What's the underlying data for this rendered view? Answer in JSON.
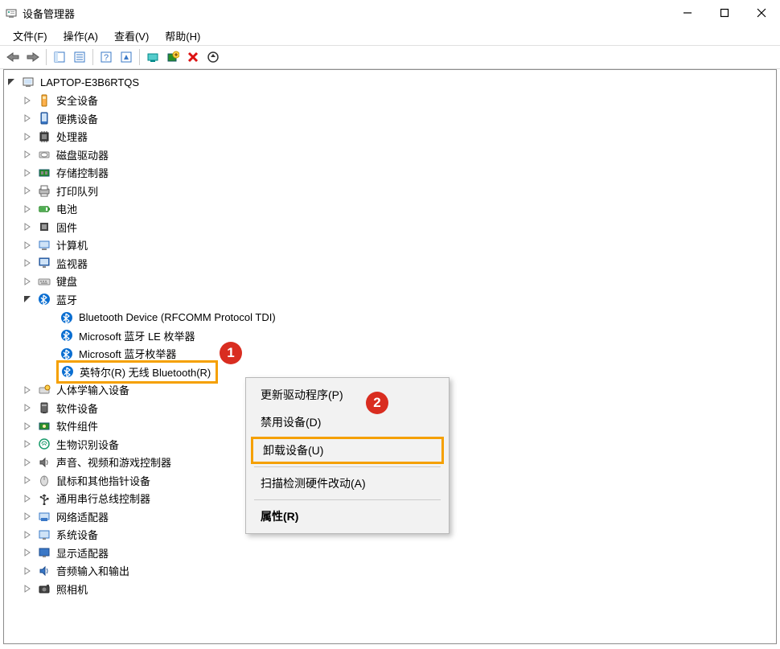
{
  "window": {
    "title": "设备管理器"
  },
  "menu": {
    "file": "文件(F)",
    "action": "操作(A)",
    "view": "查看(V)",
    "help": "帮助(H)"
  },
  "toolbar_icons": {
    "back": "back-arrow-icon",
    "forward": "forward-arrow-icon",
    "properties_panel": "panel-icon",
    "console": "console-icon",
    "help": "help-icon",
    "show_hidden": "show-icon",
    "scan": "scan-icon",
    "add_legacy": "add-hw-icon",
    "uninstall": "uninstall-x-icon",
    "update_driver": "update-driver-icon"
  },
  "root_name": "LAPTOP-E3B6RTQS",
  "categories": [
    {
      "label": "安全设备",
      "icon": "security-device-icon",
      "expanded": false
    },
    {
      "label": "便携设备",
      "icon": "portable-device-icon",
      "expanded": false
    },
    {
      "label": "处理器",
      "icon": "cpu-icon",
      "expanded": false
    },
    {
      "label": "磁盘驱动器",
      "icon": "disk-drive-icon",
      "expanded": false
    },
    {
      "label": "存储控制器",
      "icon": "storage-ctrl-icon",
      "expanded": false
    },
    {
      "label": "打印队列",
      "icon": "print-queue-icon",
      "expanded": false
    },
    {
      "label": "电池",
      "icon": "battery-icon",
      "expanded": false
    },
    {
      "label": "固件",
      "icon": "firmware-icon",
      "expanded": false
    },
    {
      "label": "计算机",
      "icon": "computer-icon",
      "expanded": false
    },
    {
      "label": "监视器",
      "icon": "monitor-icon",
      "expanded": false
    },
    {
      "label": "键盘",
      "icon": "keyboard-icon",
      "expanded": false
    },
    {
      "label": "蓝牙",
      "icon": "bluetooth-icon",
      "expanded": true,
      "children": [
        {
          "label": "Bluetooth Device (RFCOMM Protocol TDI)",
          "icon": "bluetooth-icon"
        },
        {
          "label": "Microsoft 蓝牙 LE 枚举器",
          "icon": "bluetooth-icon"
        },
        {
          "label": "Microsoft 蓝牙枚举器",
          "icon": "bluetooth-icon"
        },
        {
          "label": "英特尔(R) 无线 Bluetooth(R)",
          "icon": "bluetooth-icon",
          "selected": true
        }
      ]
    },
    {
      "label": "人体学输入设备",
      "icon": "hid-icon",
      "expanded": false
    },
    {
      "label": "软件设备",
      "icon": "software-device-icon",
      "expanded": false
    },
    {
      "label": "软件组件",
      "icon": "software-comp-icon",
      "expanded": false
    },
    {
      "label": "生物识别设备",
      "icon": "biometric-icon",
      "expanded": false
    },
    {
      "label": "声音、视频和游戏控制器",
      "icon": "audio-icon",
      "expanded": false
    },
    {
      "label": "鼠标和其他指针设备",
      "icon": "mouse-icon",
      "expanded": false
    },
    {
      "label": "通用串行总线控制器",
      "icon": "usb-icon",
      "expanded": false
    },
    {
      "label": "网络适配器",
      "icon": "network-icon",
      "expanded": false
    },
    {
      "label": "系统设备",
      "icon": "system-device-icon",
      "expanded": false
    },
    {
      "label": "显示适配器",
      "icon": "display-adapter-icon",
      "expanded": false
    },
    {
      "label": "音频输入和输出",
      "icon": "audio-io-icon",
      "expanded": false
    },
    {
      "label": "照相机",
      "icon": "camera-icon",
      "expanded": false
    }
  ],
  "context_menu": {
    "update_driver": "更新驱动程序(P)",
    "disable": "禁用设备(D)",
    "uninstall": "卸载设备(U)",
    "scan": "扫描检测硬件改动(A)",
    "properties": "属性(R)"
  },
  "callouts": {
    "one": "1",
    "two": "2"
  }
}
